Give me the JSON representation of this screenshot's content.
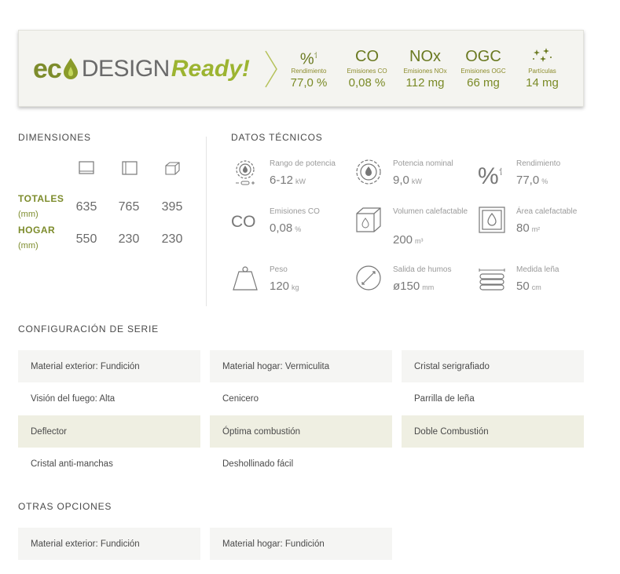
{
  "ecodesign": {
    "logo_eco": "ec",
    "logo_o": "o",
    "logo_design": "DESIGN",
    "logo_ready": "Ready!",
    "metrics": [
      {
        "symbol": "%",
        "label": "Rendimiento",
        "value": "77,0 %"
      },
      {
        "symbol": "CO",
        "label": "Emisiones CO",
        "value": "0,08 %"
      },
      {
        "symbol": "NOx",
        "label": "Emisiones NOx",
        "value": "112 mg"
      },
      {
        "symbol": "OGC",
        "label": "Emisiones OGC",
        "value": "66 mg"
      },
      {
        "symbol": "sparkle",
        "label": "Partículas",
        "value": "14 mg"
      }
    ],
    "colors": {
      "accent": "#7d8c2c",
      "accent_light": "#9cb431",
      "background": "#f4f4f0"
    }
  },
  "dimensions": {
    "title": "DIMENSIONES",
    "rows": [
      {
        "label": "TOTALES",
        "unit": "(mm)",
        "values": [
          "635",
          "765",
          "395"
        ]
      },
      {
        "label": "HOGAR",
        "unit": "(mm)",
        "values": [
          "550",
          "230",
          "230"
        ]
      }
    ],
    "icons": [
      "front-view-icon",
      "side-view-icon",
      "cube-icon"
    ]
  },
  "technical": {
    "title": "DATOS TÉCNICOS",
    "items": [
      {
        "icon": "power-range-icon",
        "label": "Rango de potencia",
        "value": "6-12",
        "unit": "kW"
      },
      {
        "icon": "nominal-power-icon",
        "label": "Potencia nominal",
        "value": "9,0",
        "unit": "kW"
      },
      {
        "icon": "efficiency-icon",
        "label": "Rendimiento",
        "value": "77,0",
        "unit": "%"
      },
      {
        "icon": "co-icon",
        "label": "Emisiones CO",
        "value": "0,08",
        "unit": "%"
      },
      {
        "icon": "volume-icon",
        "label": "Volumen calefactable",
        "value": "200",
        "unit": "m³"
      },
      {
        "icon": "area-icon",
        "label": "Área calefactable",
        "value": "80",
        "unit": "m²"
      },
      {
        "icon": "weight-icon",
        "label": "Peso",
        "value": "120",
        "unit": "kg"
      },
      {
        "icon": "smoke-outlet-icon",
        "label": "Salida de humos",
        "value": "ø150",
        "unit": "mm"
      },
      {
        "icon": "firewood-icon",
        "label": "Medida leña",
        "value": "50",
        "unit": "cm"
      }
    ],
    "co_symbol": "CO",
    "percent_symbol": "%"
  },
  "config": {
    "title": "CONFIGURACIÓN DE SERIE",
    "rows": [
      [
        "Material exterior: Fundición",
        "Material hogar: Vermiculita",
        "Cristal serigrafiado"
      ],
      [
        "Visión del fuego: Alta",
        "Cenicero",
        "Parrilla de leña"
      ],
      [
        "Deflector",
        "Óptima combustión",
        "Doble Combustión"
      ],
      [
        "Cristal anti-manchas",
        "Deshollinado fácil",
        ""
      ]
    ]
  },
  "options": {
    "title": "OTRAS OPCIONES",
    "items": [
      "Material exterior: Fundición",
      "Material hogar: Fundición"
    ]
  }
}
